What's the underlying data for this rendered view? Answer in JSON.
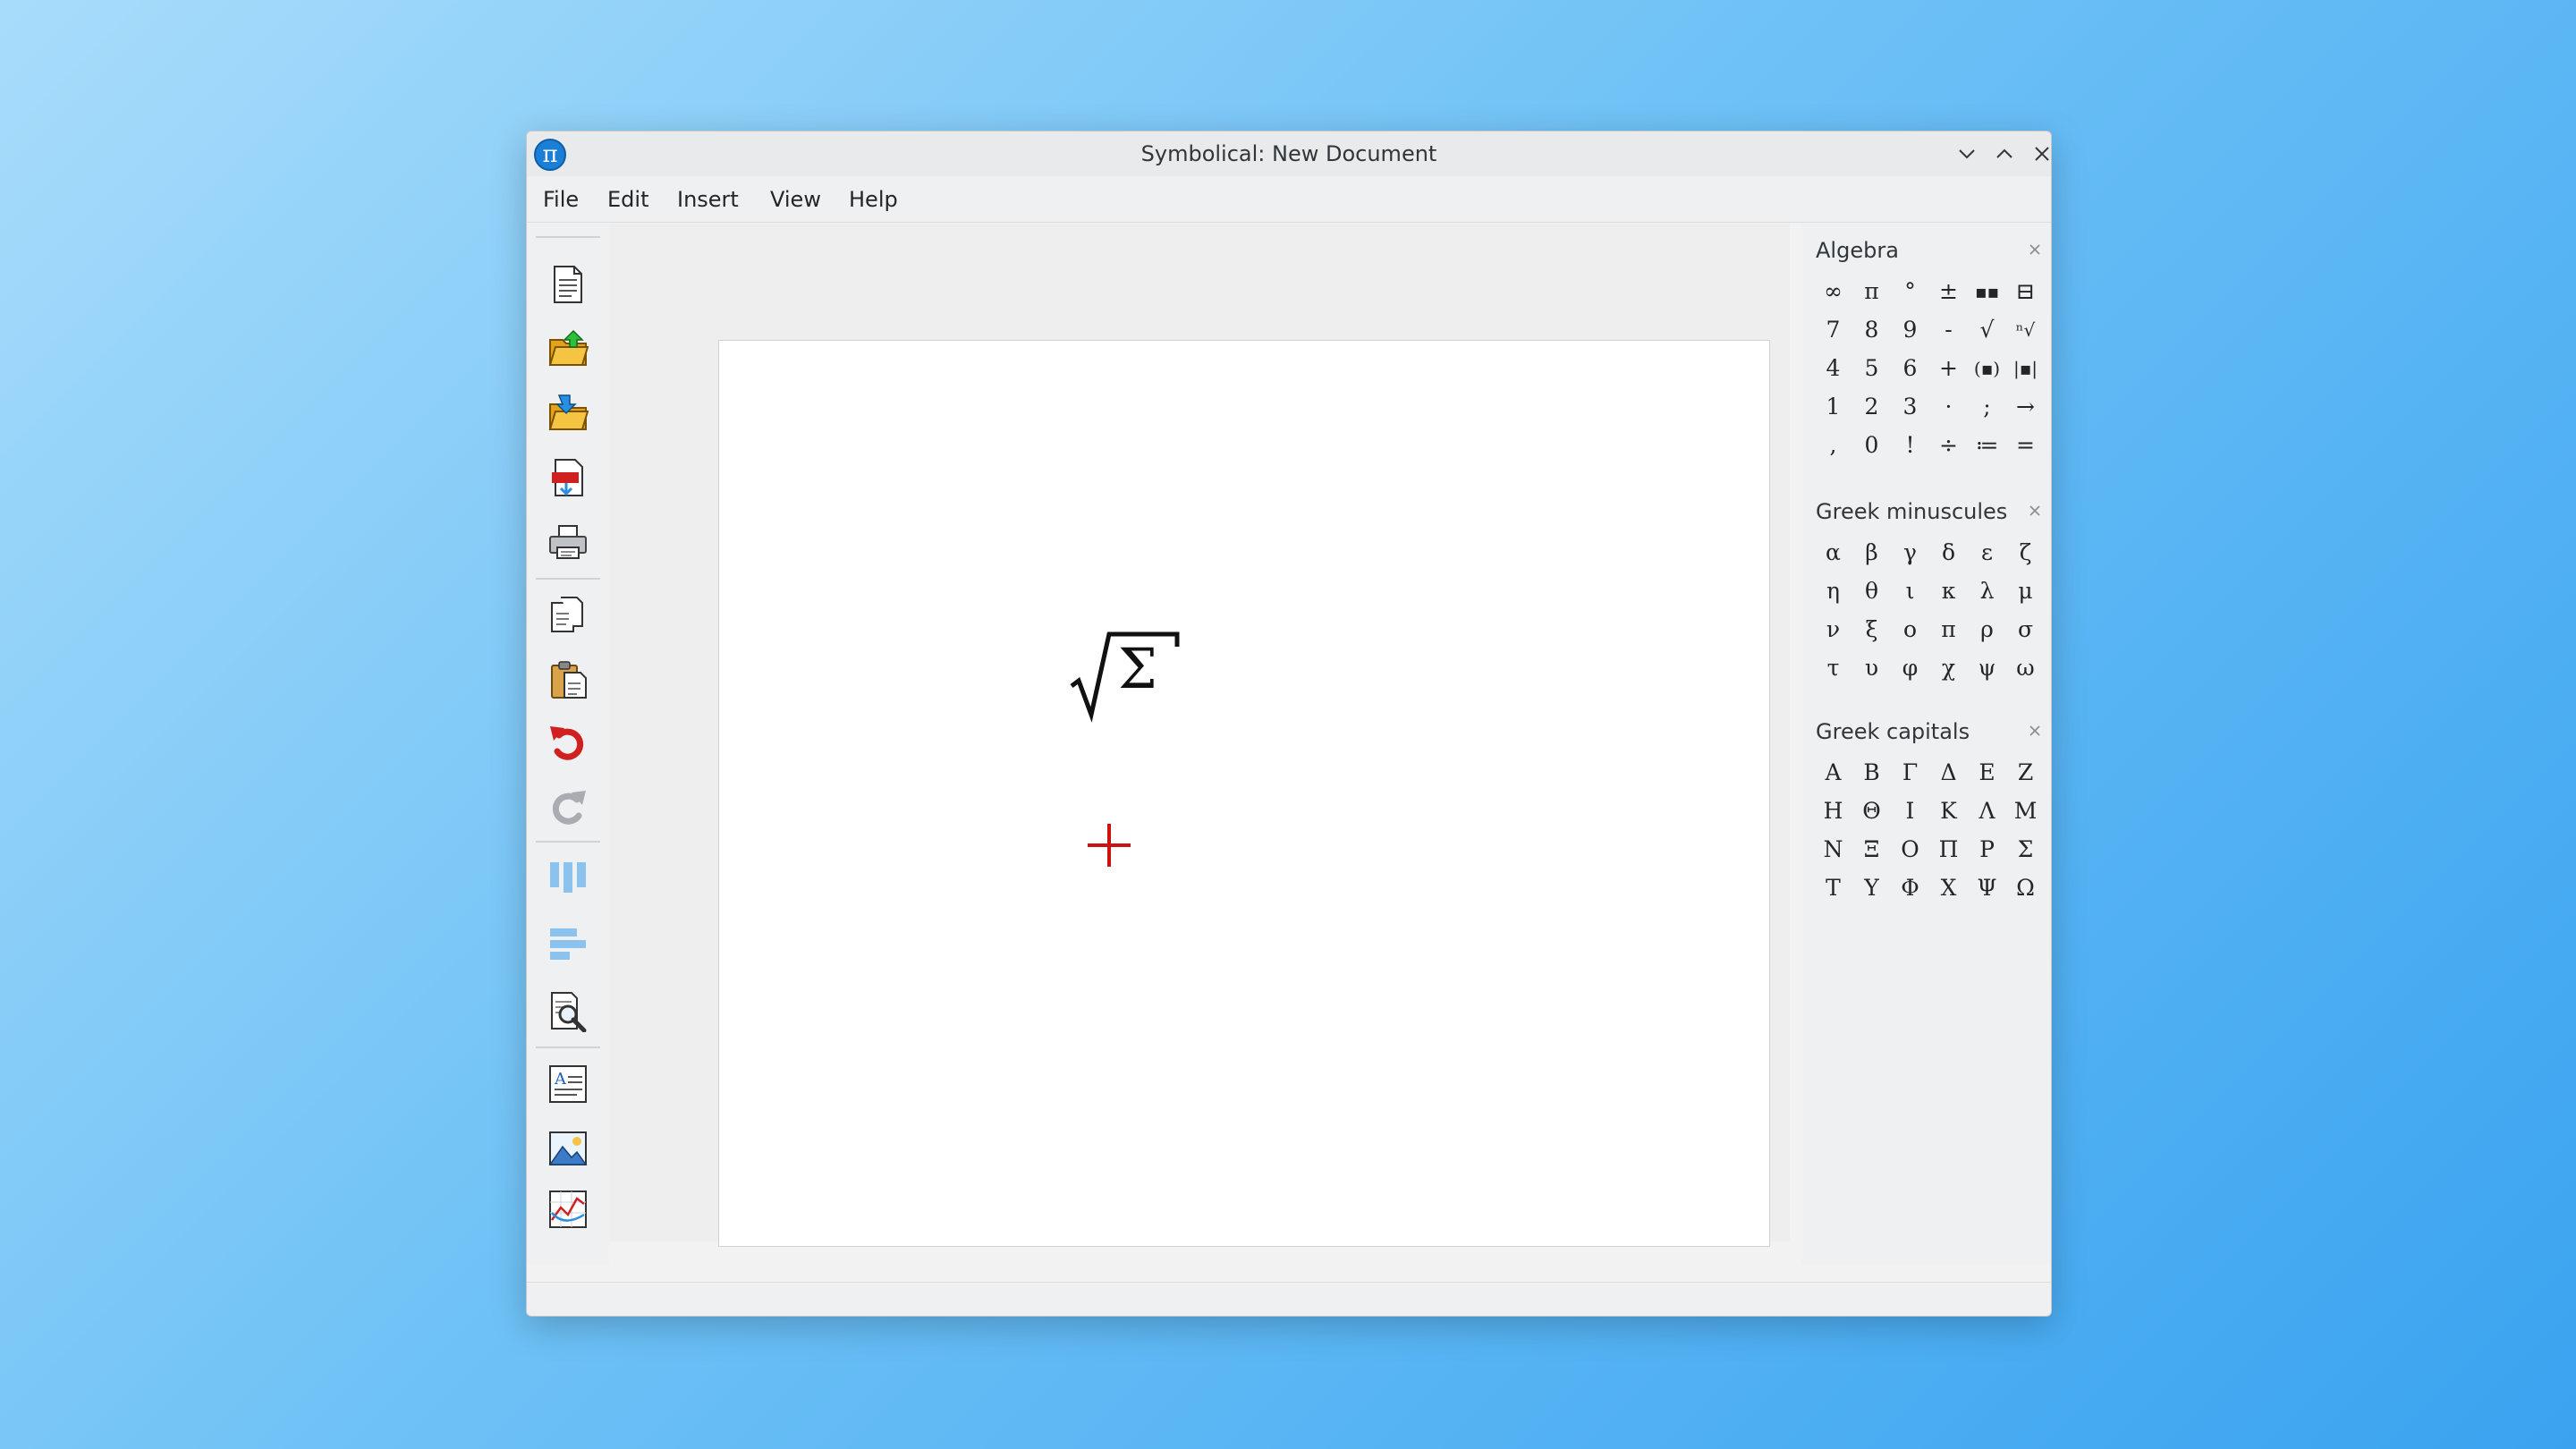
{
  "window": {
    "title": "Symbolical: New Document",
    "app_icon_glyph": "π"
  },
  "menu": [
    "File",
    "Edit",
    "Insert",
    "View",
    "Help"
  ],
  "toolbar": [
    {
      "name": "new-document-icon"
    },
    {
      "name": "open-file-icon"
    },
    {
      "name": "open-recent-icon"
    },
    {
      "name": "export-pdf-icon"
    },
    {
      "name": "print-icon"
    },
    {
      "name": "copy-icon"
    },
    {
      "name": "paste-icon"
    },
    {
      "name": "undo-icon"
    },
    {
      "name": "redo-icon"
    },
    {
      "name": "columns-icon"
    },
    {
      "name": "align-icon"
    },
    {
      "name": "search-icon"
    },
    {
      "name": "insert-text-icon"
    },
    {
      "name": "insert-image-icon"
    },
    {
      "name": "insert-plot-icon"
    }
  ],
  "document": {
    "formula_glyph": "Σ"
  },
  "panels": [
    {
      "title": "Algebra",
      "symbols": [
        "∞",
        "π",
        "°",
        "±",
        "▪▪",
        "⊟",
        "7",
        "8",
        "9",
        "-",
        "√",
        "ⁿ√",
        "4",
        "5",
        "6",
        "+",
        "(▪)",
        "|▪|",
        "1",
        "2",
        "3",
        "·",
        ";",
        "→",
        ",",
        "0",
        "!",
        "÷",
        "≔",
        "="
      ]
    },
    {
      "title": "Greek minuscules",
      "symbols": [
        "α",
        "β",
        "γ",
        "δ",
        "ε",
        "ζ",
        "η",
        "θ",
        "ι",
        "κ",
        "λ",
        "μ",
        "ν",
        "ξ",
        "ο",
        "π",
        "ρ",
        "σ",
        "τ",
        "υ",
        "φ",
        "χ",
        "ψ",
        "ω"
      ]
    },
    {
      "title": "Greek capitals",
      "symbols": [
        "Α",
        "Β",
        "Γ",
        "Δ",
        "Ε",
        "Ζ",
        "Η",
        "Θ",
        "Ι",
        "Κ",
        "Λ",
        "Μ",
        "Ν",
        "Ξ",
        "Ο",
        "Π",
        "Ρ",
        "Σ",
        "Τ",
        "Υ",
        "Φ",
        "Χ",
        "Ψ",
        "Ω"
      ]
    }
  ],
  "colors": {
    "accent": "#1c7fd6",
    "cursor": "#cc1111",
    "undo": "#d02020"
  }
}
